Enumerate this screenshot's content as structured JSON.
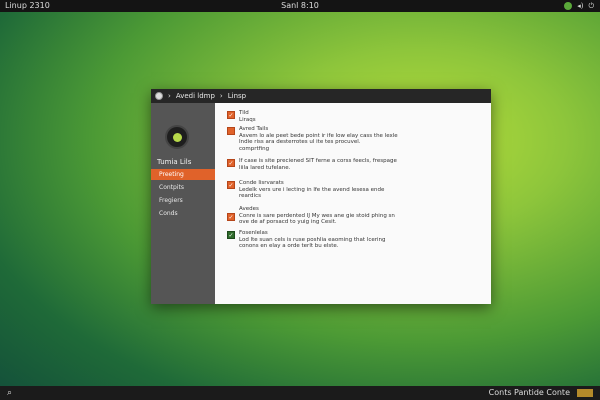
{
  "topbar": {
    "left_label": "Linuр 2310",
    "center_label": "Sanl 8:10",
    "tray_icons": [
      "green-status-icon",
      "speaker-icon",
      "power-icon"
    ]
  },
  "window": {
    "title_crumbs": [
      "Avedi ldmp",
      "Linsp"
    ],
    "sidebar": {
      "brand": "Tumia Lils",
      "items": [
        {
          "label": "Preeting",
          "active": true
        },
        {
          "label": "Contpits",
          "active": false
        },
        {
          "label": "Fregiers",
          "active": false
        },
        {
          "label": "Conds",
          "active": false
        }
      ]
    },
    "entries": [
      {
        "checked": true,
        "lines": [
          "Tild",
          "Liraqs"
        ]
      },
      {
        "checked": false,
        "lines": [
          "Avred Tails",
          "Asvem lo ale peet bede point ir ife low elay cass the lexle",
          "Indie riss ara desterrotes ul ite tes procuvel.",
          "comprtfing"
        ]
      },
      {
        "checked": true,
        "lines": [
          "If case is site preciened SIT ferne a corss feecls, frespage",
          "liila lared tufelane."
        ]
      },
      {
        "checked": true,
        "lines": [
          "Conde lisrvarats",
          "Ledelk vers ure i lecting in lfe the avend lesesa ende",
          "reardics"
        ]
      },
      {
        "checked": true,
        "lines": [
          "Avedes",
          "Conre is sare perdented IJ My wes ane gie stoid phing sn",
          "ove de af porsacd to yuig ing Cesit."
        ]
      },
      {
        "checked": true,
        "dark": true,
        "lines": [
          "Fosenlelas",
          "Lod lte suan cels is ruse poshlia eaoming that lcering",
          "conons en elay a orde terlt bu elste."
        ]
      }
    ]
  },
  "bottombar": {
    "search_icon": "search-icon",
    "right_label": "Conts Pantide Conte"
  }
}
